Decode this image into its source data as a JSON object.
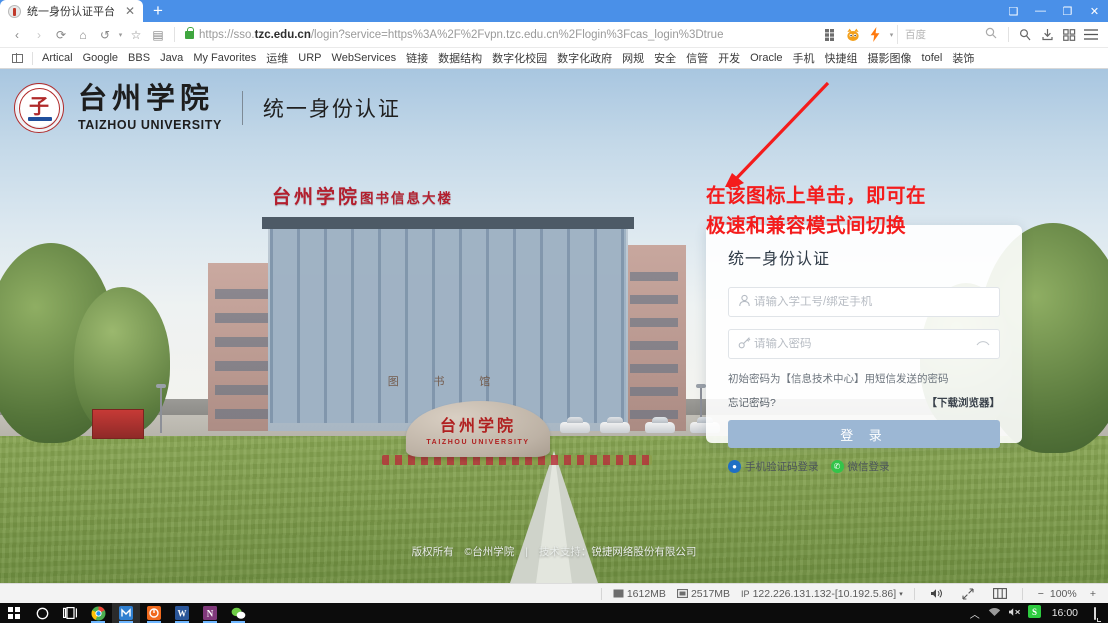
{
  "browser": {
    "tab": {
      "title": "统一身份认证平台",
      "close_label": "✕",
      "favicon": "shield-favicon"
    },
    "new_tab_label": "+",
    "window_controls": {
      "split": "❑",
      "minimize": "—",
      "maximize": "❐",
      "close": "✕"
    },
    "nav": {
      "back": "‹",
      "forward": "›",
      "reload": "⟳",
      "home": "⌂",
      "history": "↺",
      "history_caret": "▾",
      "bookmark_star": "☆",
      "reader": "▤"
    },
    "address": {
      "scheme": "https://sso.",
      "domain": "tzc.edu.cn",
      "path": "/login?service=https%3A%2F%2Fvpn.tzc.edu.cn%2Flogin%3Fcas_login%3Dtrue",
      "full": "https://sso.tzc.edu.cn/login?service=https%3A%2F%2Fvpn.tzc.edu.cn%2Flogin%3Fcas_login%3Dtrue",
      "secure_icon": "lock-icon"
    },
    "toolbar_right": {
      "apps_icon": "apps-grid-icon",
      "mode_icon": "compatibility-mode-icon",
      "speed_icon": "lightning-speed-icon",
      "mode_caret": "▾",
      "search_engine": "百度",
      "search_icon": "search-icon",
      "account_icon": "account-icon",
      "download_icon": "download-icon",
      "extensions_icon": "extensions-icon",
      "menu_icon": "hamburger-menu-icon"
    },
    "bookmarks": [
      {
        "label": "Artical",
        "caret": "▾"
      },
      {
        "label": "Google",
        "caret": "▾"
      },
      {
        "label": "BBS",
        "caret": "▾"
      },
      {
        "label": "Java",
        "caret": "▾"
      },
      {
        "label": "My Favorites",
        "caret": "▾"
      },
      {
        "label": "运维",
        "caret": "▾"
      },
      {
        "label": "URP",
        "caret": "▾"
      },
      {
        "label": "WebServices",
        "caret": "▾"
      },
      {
        "label": "链接",
        "caret": "▾"
      },
      {
        "label": "数据结构",
        "caret": "▾"
      },
      {
        "label": "数字化校园",
        "caret": "▾"
      },
      {
        "label": "数字化政府",
        "caret": "▾"
      },
      {
        "label": "网规",
        "caret": "▾"
      },
      {
        "label": "安全",
        "caret": "▾"
      },
      {
        "label": "信管",
        "caret": "▾"
      },
      {
        "label": "开发",
        "caret": "▾"
      },
      {
        "label": "Oracle",
        "caret": "▾"
      },
      {
        "label": "手机",
        "caret": "▾"
      },
      {
        "label": "快捷组",
        "caret": "▾"
      },
      {
        "label": "摄影图像",
        "caret": "▾"
      },
      {
        "label": "tofel",
        "caret": "▾"
      },
      {
        "label": "装饰",
        "caret": "▾"
      }
    ],
    "status": {
      "memory_icon": "memory-icon",
      "memory": "1612MB",
      "disk_icon": "disk-icon",
      "disk": "2517MB",
      "ip_label": "IP",
      "ip": "122.226.131.132-[10.192.5.86]",
      "ip_caret": "▾",
      "sound_icon": "speaker-icon",
      "fullscreen_icon": "fullscreen-icon",
      "split_icon": "split-view-icon",
      "zoom_out": "−",
      "zoom_value": "100%",
      "zoom_in": "+"
    }
  },
  "page": {
    "header": {
      "logo_name": "taizhou-university-seal",
      "logo_mark": "子",
      "university_cn": "台州学院",
      "university_en": "TAIZHOU UNIVERSITY",
      "subtitle": "统一身份认证"
    },
    "annotation": {
      "line1": "在该图标上单击，即可在",
      "line2": "极速和兼容模式间切换",
      "color": "#f41c1c",
      "arrow": "red-arrow-annotation"
    },
    "scene": {
      "building_roof_cn": "台州学院",
      "building_roof_sub": "图书信息大楼",
      "building_entry": "图 书 馆",
      "stone_cn": "台州学院",
      "stone_en": "TAIZHOU UNIVERSITY"
    },
    "login": {
      "title": "统一身份认证",
      "username": {
        "icon": "user-icon",
        "value": "",
        "placeholder": "请输入学工号/绑定手机"
      },
      "password": {
        "icon": "key-icon",
        "value": "",
        "placeholder": "请输入密码",
        "toggle_icon": "eye-toggle-icon"
      },
      "hint": "初始密码为【信息技术中心】用短信发送的密码",
      "forgot": "忘记密码?",
      "download_browser": "【下载浏览器】",
      "submit": "登 录",
      "alternatives": [
        {
          "label": "手机验证码登录",
          "icon": "phone-code-icon",
          "color": "#1f6fc4"
        },
        {
          "label": "微信登录",
          "icon": "wechat-icon",
          "color": "#33c44a"
        }
      ]
    },
    "footer": {
      "copyright_label": "版权所有",
      "copyright": "©台州学院",
      "divider": "|",
      "support": "技术支持：锐捷网络股份有限公司"
    }
  },
  "taskbar": {
    "start": "windows-start-icon",
    "cortana": "cortana-search-icon",
    "taskview": "task-view-icon",
    "apps": [
      {
        "name": "chrome-icon"
      },
      {
        "name": "maxthon-browser-icon"
      },
      {
        "name": "360-browser-icon"
      },
      {
        "name": "word-icon"
      },
      {
        "name": "onenote-icon"
      },
      {
        "name": "wechat-icon"
      }
    ],
    "tray": {
      "expand": "︿",
      "network": "wifi-icon",
      "volume": "volume-muted-icon",
      "ime": "sogou-ime-icon",
      "ime_label": "S",
      "clock": "16:00",
      "notifications": "notification-center-icon"
    }
  }
}
